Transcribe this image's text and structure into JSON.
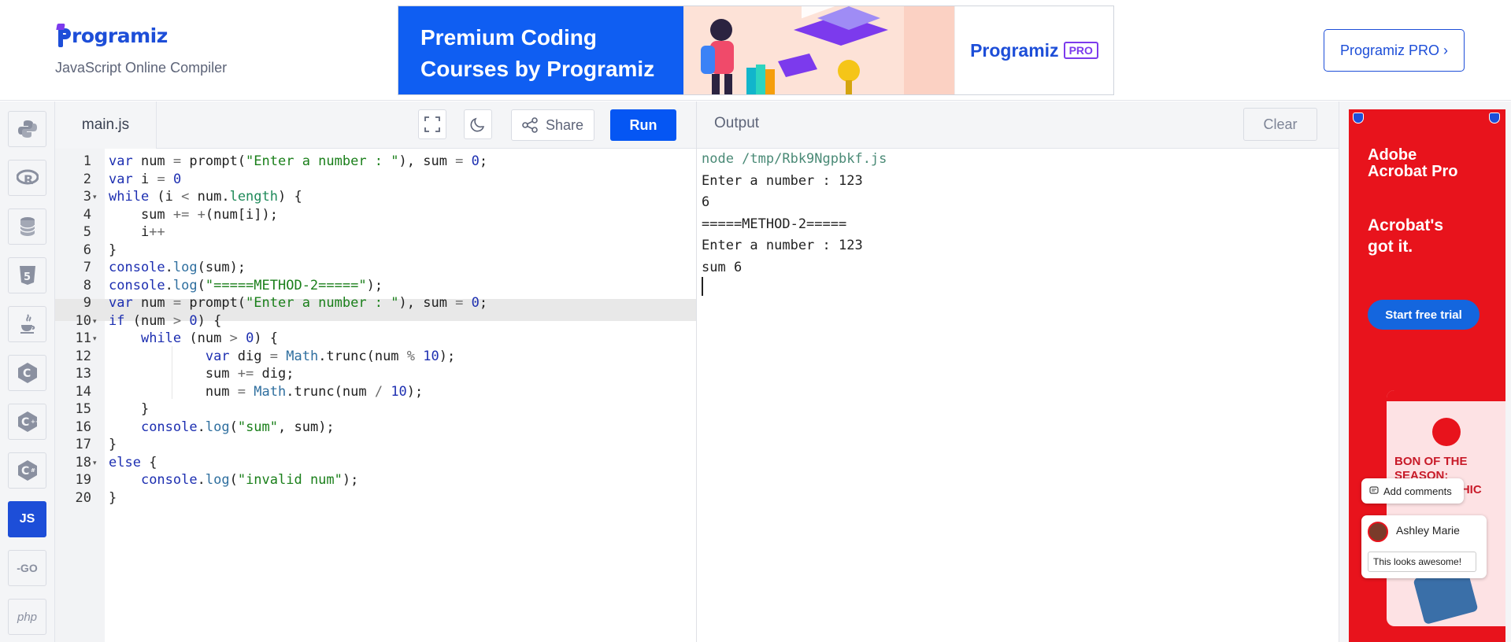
{
  "header": {
    "logo_text": "rogramiz",
    "subtitle": "JavaScript Online Compiler",
    "banner_line1": "Premium Coding",
    "banner_line2": "Courses by Programiz",
    "banner_pro_text": "Programiz",
    "banner_pro_badge": "PRO",
    "pro_button": "Programiz PRO ›"
  },
  "sidebar": {
    "items": [
      {
        "name": "python",
        "label": ""
      },
      {
        "name": "r",
        "label": "R"
      },
      {
        "name": "sql",
        "label": ""
      },
      {
        "name": "html",
        "label": "5"
      },
      {
        "name": "java",
        "label": ""
      },
      {
        "name": "c",
        "label": "C"
      },
      {
        "name": "cpp",
        "label": "C"
      },
      {
        "name": "csharp",
        "label": "C"
      },
      {
        "name": "js",
        "label": "JS"
      },
      {
        "name": "go",
        "label": "-GO"
      },
      {
        "name": "php",
        "label": "php"
      }
    ]
  },
  "editor": {
    "filename": "main.js",
    "share_label": "Share",
    "run_label": "Run",
    "active_line": 8,
    "lines": [
      "var num = prompt(\"Enter a number : \"), sum = 0;",
      "var i = 0",
      "while (i < num.length) {",
      "    sum += +(num[i]);",
      "    i++",
      "}",
      "console.log(sum);",
      "console.log(\"=====METHOD-2=====\");",
      "var num = prompt(\"Enter a number : \"), sum = 0;",
      "if (num > 0) {",
      "    while (num > 0) {",
      "            var dig = Math.trunc(num % 10);",
      "            sum += dig;",
      "            num = Math.trunc(num / 10);",
      "    }",
      "    console.log(\"sum\", sum);",
      "}",
      "else {",
      "    console.log(\"invalid num\");",
      "}"
    ]
  },
  "output": {
    "title": "Output",
    "clear_label": "Clear",
    "lines": [
      "node /tmp/Rbk9Ngpbkf.js",
      "Enter a number : 123",
      "6",
      "=====METHOD-2=====",
      "Enter a number : 123",
      "sum 6"
    ]
  },
  "ad": {
    "brand_line1": "Adobe",
    "brand_line2": "Acrobat Pro",
    "headline_line1": "Acrobat's",
    "headline_line2": "got it.",
    "cta": "Start free trial",
    "bon_line1": "BON OF THE",
    "bon_line2": "SEASON:",
    "bon_line3": "RPHIC",
    "comments_label": "Add comments",
    "user_name": "Ashley Marie",
    "user_message": "This looks awesome!"
  },
  "colors": {
    "brand": "#1d4ed8",
    "run": "#0556f3",
    "ad_red": "#e8131c"
  }
}
